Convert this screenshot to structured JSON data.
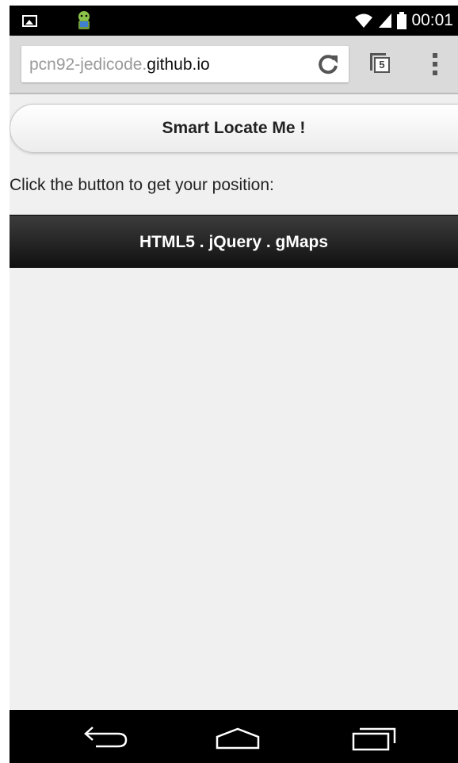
{
  "status_bar": {
    "time": "00:01",
    "icons": [
      "image-notification-icon",
      "android-notification-icon",
      "wifi-icon",
      "signal-icon",
      "battery-icon"
    ]
  },
  "browser": {
    "url_subdomain": "pcn92-jedicode.",
    "url_host": "github.io",
    "tab_count": "5",
    "icons": [
      "refresh-icon",
      "tabs-icon",
      "menu-icon"
    ]
  },
  "page": {
    "locate_button_label": "Smart Locate Me !",
    "info_text": "Click the button to get your position:",
    "footer_text": "HTML5 . jQuery . gMaps"
  },
  "nav_bar": {
    "icons": [
      "back-icon",
      "home-icon",
      "recent-apps-icon"
    ]
  },
  "colors": {
    "status_bar": "#000000",
    "url_bar_bg": "#dadada",
    "page_bg": "#f0f0f0",
    "footer_bar": "#1e1e1e"
  }
}
